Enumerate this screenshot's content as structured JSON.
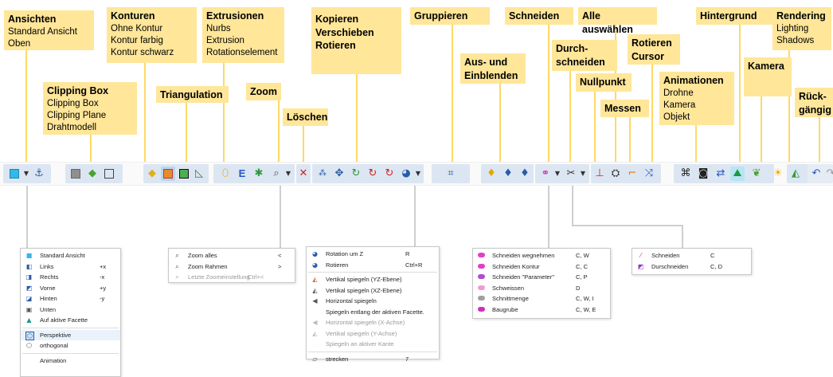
{
  "callouts": {
    "ansichten": {
      "title": "Ansichten",
      "items": [
        "Standard Ansicht",
        "Oben"
      ]
    },
    "clipping": {
      "title": "Clipping Box",
      "items": [
        "Clipping Box",
        "Clipping Plane",
        "Drahtmodell"
      ]
    },
    "konturen": {
      "title": "Konturen",
      "items": [
        "Ohne Kontur",
        "Kontur farbig",
        "Kontur schwarz"
      ]
    },
    "triangulation": {
      "title": "Triangulation"
    },
    "extrusionen": {
      "title": "Extrusionen",
      "items": [
        "Nurbs",
        "Extrusion",
        "Rotationselement"
      ]
    },
    "zoom": {
      "title": "Zoom"
    },
    "loeschen": {
      "title": "Löschen"
    },
    "kopieren": {
      "lines": [
        "Kopieren",
        "Verschieben",
        "Rotieren"
      ]
    },
    "gruppieren": {
      "title": "Gruppieren"
    },
    "ausein": {
      "lines": [
        "Aus- und",
        "Einblenden"
      ]
    },
    "schneiden": {
      "title": "Schneiden"
    },
    "durch": {
      "lines": [
        "Durch-",
        "schneiden"
      ]
    },
    "alle": {
      "title": "Alle auswählen"
    },
    "nullpunkt": {
      "title": "Nullpunkt"
    },
    "messen": {
      "title": "Messen"
    },
    "rotcursor": {
      "lines": [
        "Rotieren",
        "Cursor"
      ]
    },
    "animationen": {
      "title": "Animationen",
      "items": [
        "Drohne",
        "Kamera",
        "Objekt"
      ]
    },
    "hintergrund": {
      "title": "Hintergrund"
    },
    "kamera": {
      "title": "Kamera"
    },
    "rendering": {
      "title": "Rendering",
      "items": [
        "Lighting",
        "Shadows"
      ]
    },
    "rueck": {
      "lines": [
        "Rück-",
        "gängig"
      ]
    }
  },
  "menus": {
    "ansichten": {
      "items": [
        {
          "label": "Standard Ansicht",
          "shortcut": ""
        },
        {
          "label": "Links",
          "shortcut": "+x"
        },
        {
          "label": "Rechts",
          "shortcut": "-x"
        },
        {
          "label": "Vorne",
          "shortcut": "+y"
        },
        {
          "label": "Hinten",
          "shortcut": "-y"
        },
        {
          "label": "Unten",
          "shortcut": ""
        },
        {
          "label": "Auf aktive Facette",
          "shortcut": ""
        },
        {
          "label": "Perspektive",
          "shortcut": ""
        },
        {
          "label": "orthogonal",
          "shortcut": ""
        },
        {
          "label": "Animation",
          "shortcut": ""
        }
      ]
    },
    "zoom": {
      "items": [
        {
          "label": "Zoom alles",
          "shortcut": "<"
        },
        {
          "label": "Zoom Rahmen",
          "shortcut": ">"
        },
        {
          "label": "Letzte Zoomeinstellung",
          "shortcut": "Ctrl+<"
        }
      ]
    },
    "transform": {
      "items": [
        {
          "label": "Rotation um Z",
          "shortcut": "R"
        },
        {
          "label": "Rotieren",
          "shortcut": "Ctrl+R"
        },
        {
          "label": "Vertikal spiegeln (YZ-Ebene)",
          "shortcut": ""
        },
        {
          "label": "Vertikal spiegeln (XZ-Ebene)",
          "shortcut": ""
        },
        {
          "label": "Horizontal spiegeln",
          "shortcut": ""
        },
        {
          "label": "Spiegeln entlang der aktiven Facette.",
          "shortcut": ""
        },
        {
          "label": "Horizontal spiegeln (X-Achse)",
          "shortcut": ""
        },
        {
          "label": "Vertikal spiegeln (Y-Achse)",
          "shortcut": ""
        },
        {
          "label": "Spiegeln an aktiver Kante",
          "shortcut": ""
        },
        {
          "label": "strecken",
          "shortcut": "7"
        }
      ]
    },
    "schneiden": {
      "items": [
        {
          "label": "Schneiden wegnehmen",
          "shortcut": "C, W"
        },
        {
          "label": "Schneiden Kontur",
          "shortcut": "C, C"
        },
        {
          "label": "Schneiden \"Parameter\"",
          "shortcut": "C, P"
        },
        {
          "label": "Schweissen",
          "shortcut": "D"
        },
        {
          "label": "Schnittmenge",
          "shortcut": "C, W, I"
        },
        {
          "label": "Baugrube",
          "shortcut": "C, W, E"
        }
      ]
    },
    "durch": {
      "items": [
        {
          "label": "Schneiden",
          "shortcut": "C"
        },
        {
          "label": "Durschneiden",
          "shortcut": "C, D"
        }
      ]
    }
  },
  "toolbar": {
    "extrusion_letter": "E"
  },
  "colors": {
    "callout_bg": "#ffe699",
    "leader": "#ffd966",
    "toolbar_group": "#dce6f2"
  }
}
